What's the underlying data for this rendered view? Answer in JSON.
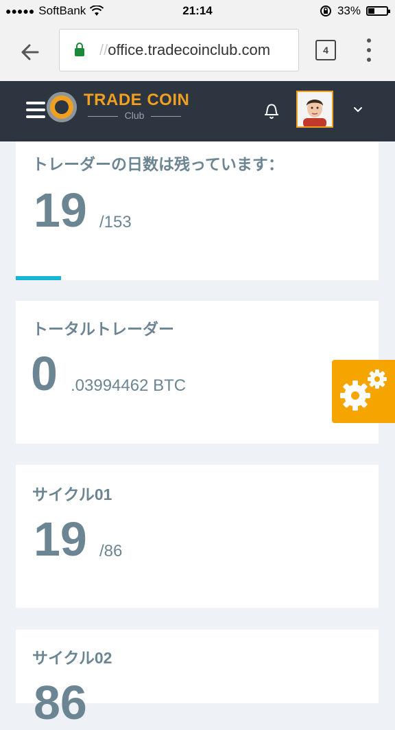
{
  "status_bar": {
    "signal_dots": "●●●●●",
    "carrier": "SoftBank",
    "time": "21:14",
    "battery_percent": "33%",
    "battery_level": 0.33
  },
  "browser": {
    "url_faded": "//",
    "url": "office.tradecoinclub.com",
    "tab_count": "4"
  },
  "app_header": {
    "logo_title": "TRADE COIN",
    "logo_subtitle": "Club"
  },
  "cards": [
    {
      "title": "トレーダーの日数は残っています：",
      "value": "19",
      "suffix": "/153",
      "progress": 0.125
    },
    {
      "title": "トータルトレーダー",
      "value": "0",
      "suffix": ".03994462 BTC"
    },
    {
      "title": "サイクル01",
      "value": "19",
      "suffix": "/86"
    },
    {
      "title": "サイクル02",
      "value": "86"
    }
  ],
  "colors": {
    "header_bg": "#2d3540",
    "accent_orange": "#f5a400",
    "progress_cyan": "#19b5d4",
    "text_slate": "#6c8593"
  },
  "icons": {
    "settings_widget": "gears-icon",
    "notifications": "bell-icon",
    "user_menu": "chevron-down-icon"
  }
}
